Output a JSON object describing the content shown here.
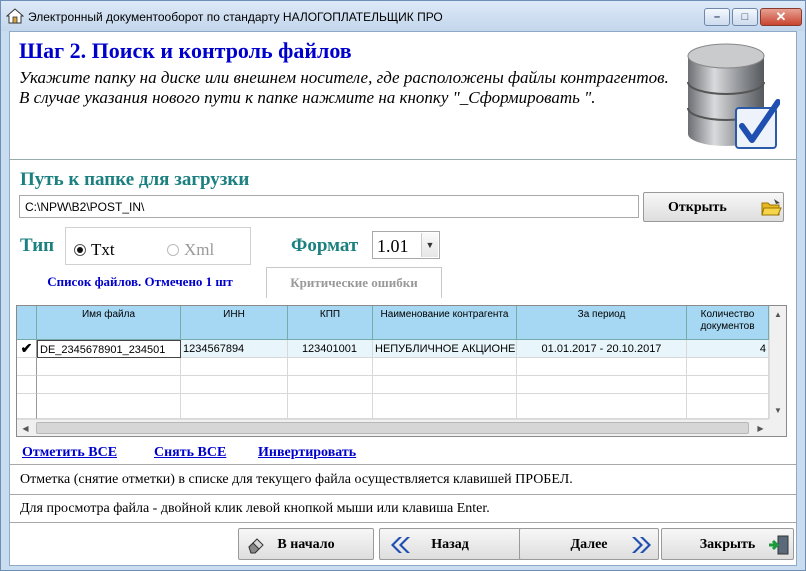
{
  "window": {
    "title": "Электронный документооборот по стандарту НАЛОГОПЛАТЕЛЬЩИК ПРО",
    "controls": {
      "minimize": "–",
      "maximize": "□",
      "close": "✕"
    }
  },
  "header": {
    "step_title": "Шаг 2. Поиск и контроль файлов",
    "description": "Укажите папку на диске или внешнем носителе, где расположены файлы контрагентов. В случае указания нового пути к папке нажмите на кнопку \"_Сформировать \"."
  },
  "path": {
    "label": "Путь к папке для загрузки",
    "value": "C:\\NPW\\B2\\POST_IN\\",
    "open_button": "Открыть"
  },
  "type": {
    "label": "Тип",
    "options": [
      {
        "label": "Txt",
        "selected": true
      },
      {
        "label": "Xml",
        "selected": false
      }
    ]
  },
  "format": {
    "label": "Формат",
    "value": "1.01"
  },
  "tabs": [
    {
      "label": "Список файлов. Отмечено 1 шт",
      "active": true
    },
    {
      "label": "Критические ошибки",
      "active": false
    }
  ],
  "grid": {
    "columns": [
      "Имя файла",
      "ИНН",
      "КПП",
      "Наименование контрагента",
      "За период",
      "Количество документов"
    ],
    "rows": [
      {
        "checked": true,
        "check_mark": "✔",
        "file": "DE_2345678901_234501",
        "inn": "1234567894",
        "kpp": "123401001",
        "name": "НЕПУБЛИЧНОЕ АКЦИОНЕ",
        "period": "01.01.2017 - 20.10.2017",
        "count": "4"
      }
    ]
  },
  "actions": {
    "select_all": "Отметить ВСЕ",
    "clear_all": "Снять ВСЕ",
    "invert": "Инвертировать"
  },
  "notes": {
    "marking": "Отметка (снятие отметки) в списке для текущего файла осуществляется клавишей ПРОБЕЛ.",
    "view": "Для просмотра файла - двойной клик левой кнопкой мыши или клавиша Enter."
  },
  "footer": {
    "home": "В начало",
    "back": "Назад",
    "next": "Далее",
    "close": "Закрыть"
  },
  "colors": {
    "title_blue": "#0000cc",
    "section_teal": "#1c8080",
    "grid_header": "#a6d8f4",
    "selected_row": "#e8f6fb"
  }
}
